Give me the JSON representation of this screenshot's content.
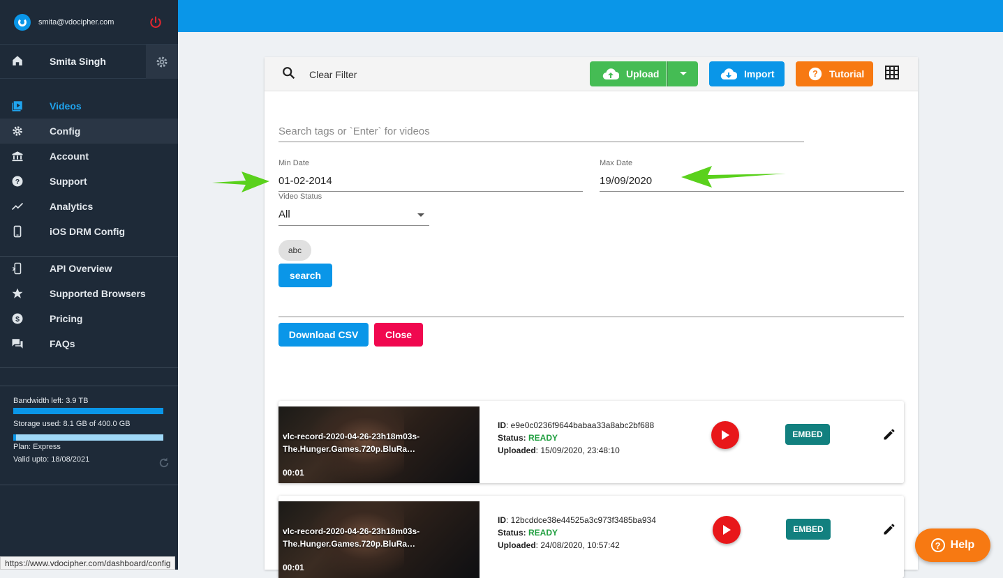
{
  "account": {
    "email": "smita@vdocipher.com",
    "user_name": "Smita Singh"
  },
  "nav_primary": [
    {
      "label": "Videos",
      "icon": "video-library-icon",
      "active": true
    },
    {
      "label": "Config",
      "icon": "gear-icon"
    },
    {
      "label": "Account",
      "icon": "bank-icon"
    },
    {
      "label": "Support",
      "icon": "help-circle-icon"
    },
    {
      "label": "Analytics",
      "icon": "trending-icon"
    },
    {
      "label": "iOS DRM Config",
      "icon": "phone-icon"
    }
  ],
  "nav_secondary": [
    {
      "label": "API Overview",
      "icon": "api-icon"
    },
    {
      "label": "Supported Browsers",
      "icon": "star-icon"
    },
    {
      "label": "Pricing",
      "icon": "dollar-icon"
    },
    {
      "label": "FAQs",
      "icon": "forum-icon"
    }
  ],
  "stats": {
    "bandwidth": "Bandwidth left: 3.9 TB",
    "bandwidth_fraction": 1.0,
    "storage": "Storage used: 8.1 GB of 400.0 GB",
    "storage_fraction": 0.02,
    "plan": "Plan: Express",
    "valid": "Valid upto: 18/08/2021"
  },
  "toolbar": {
    "clear_filter": "Clear Filter",
    "upload": "Upload",
    "import": "Import",
    "tutorial": "Tutorial"
  },
  "filters": {
    "search_placeholder": "Search tags or `Enter` for videos",
    "min_date_label": "Min Date",
    "min_date": "01-02-2014",
    "max_date_label": "Max Date",
    "max_date": "19/09/2020",
    "status_label": "Video Status",
    "status_value": "All",
    "tag_chip": "abc",
    "search_button": "search",
    "download_csv": "Download CSV",
    "close": "Close"
  },
  "videos": [
    {
      "title": "vlc-record-2020-04-26-23h18m03s-The.Hunger.Games.720p.BluRa…",
      "duration": "00:01",
      "id_label": "ID",
      "id": "e9e0c0236f9644babaa33a8abc2bf688",
      "status_label": "Status:",
      "status": "READY",
      "uploaded_label": "Uploaded",
      "uploaded": "15/09/2020, 23:48:10",
      "embed": "EMBED"
    },
    {
      "title": "vlc-record-2020-04-26-23h18m03s-The.Hunger.Games.720p.BluRa…",
      "duration": "00:01",
      "id_label": "ID",
      "id": "12bcddce38e44525a3c973f3485ba934",
      "status_label": "Status:",
      "status": "READY",
      "uploaded_label": "Uploaded",
      "uploaded": "24/08/2020, 10:57:42",
      "embed": "EMBED"
    }
  ],
  "status_url": "https://www.vdocipher.com/dashboard/config",
  "help": "Help",
  "colors": {
    "primary": "#0a96e8",
    "sidebar": "#1e2a38",
    "green": "#45bc54",
    "orange": "#f77912",
    "red": "#e8171a",
    "teal": "#12807f",
    "close": "#f0084f",
    "arrow": "#5ad11c"
  }
}
